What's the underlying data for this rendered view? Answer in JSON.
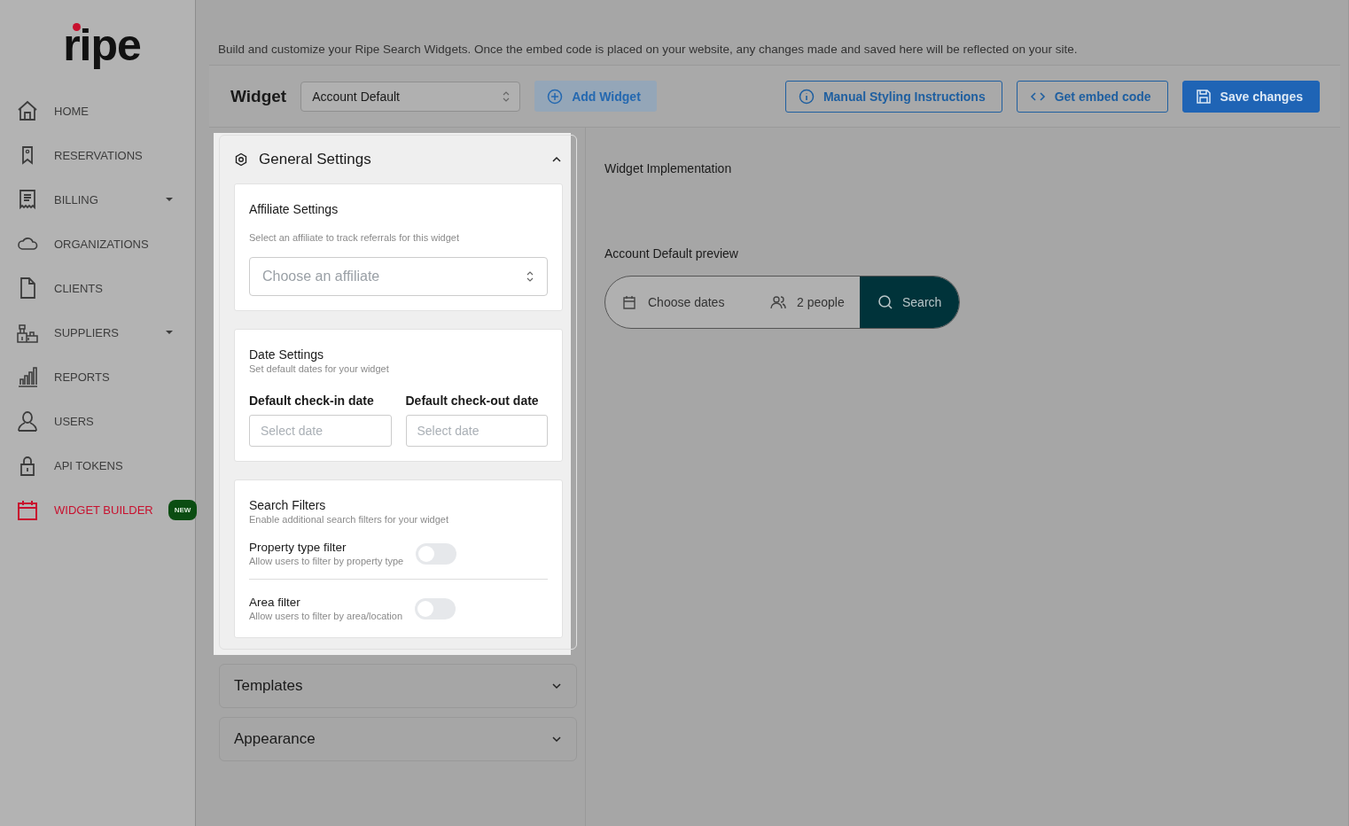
{
  "sidebar": {
    "logo": "ripe",
    "items": [
      {
        "label": "HOME",
        "selected": false,
        "expandable": false
      },
      {
        "label": "RESERVATIONS",
        "selected": false,
        "expandable": false
      },
      {
        "label": "BILLING",
        "selected": false,
        "expandable": true
      },
      {
        "label": "ORGANIZATIONS",
        "selected": false,
        "expandable": false
      },
      {
        "label": "CLIENTS",
        "selected": false,
        "expandable": false
      },
      {
        "label": "SUPPLIERS",
        "selected": false,
        "expandable": true
      },
      {
        "label": "REPORTS",
        "selected": false,
        "expandable": false
      },
      {
        "label": "USERS",
        "selected": false,
        "expandable": false
      },
      {
        "label": "API TOKENS",
        "selected": false,
        "expandable": false
      },
      {
        "label": "WIDGET BUILDER",
        "selected": true,
        "expandable": false,
        "badge": "NEW"
      }
    ]
  },
  "description": "Build and customize your Ripe Search Widgets. Once the embed code is placed on your website, any changes made and saved here will be reflected on your site.",
  "toolbar": {
    "title": "Widget",
    "widget_select": "Account Default",
    "add_button": "Add Widget",
    "buttons": [
      {
        "label": "Manual Styling Instructions",
        "kind": "info"
      },
      {
        "label": "Get embed code",
        "kind": "code"
      },
      {
        "label": "Save changes",
        "kind": "save"
      }
    ]
  },
  "sections": [
    {
      "title": "General Settings",
      "expanded": true,
      "affiliate": {
        "title": "Affiliate Settings",
        "subtitle": "Select an affiliate to track referrals for this widget",
        "placeholder": "Choose an affiliate"
      },
      "dates": {
        "title": "Date Settings",
        "subtitle": "Set default dates for your widget",
        "fields": [
          {
            "label": "Default check-in date",
            "placeholder": "Select date"
          },
          {
            "label": "Default check-out date",
            "placeholder": "Select date"
          }
        ]
      },
      "filters": {
        "title": "Search Filters",
        "subtitle": "Enable additional search filters for your widget",
        "items": [
          {
            "label": "Property type filter",
            "hint": "Allow users to filter by property type",
            "on": false
          },
          {
            "label": "Area filter",
            "hint": "Allow users to filter by area/location",
            "on": false
          }
        ]
      }
    },
    {
      "title": "Templates",
      "expanded": false
    },
    {
      "title": "Appearance",
      "expanded": false
    }
  ],
  "preview": {
    "implementation_title": "Widget Implementation",
    "preview_title": "Account Default preview",
    "dates": "Choose dates",
    "people": "2 people",
    "search": "Search"
  }
}
